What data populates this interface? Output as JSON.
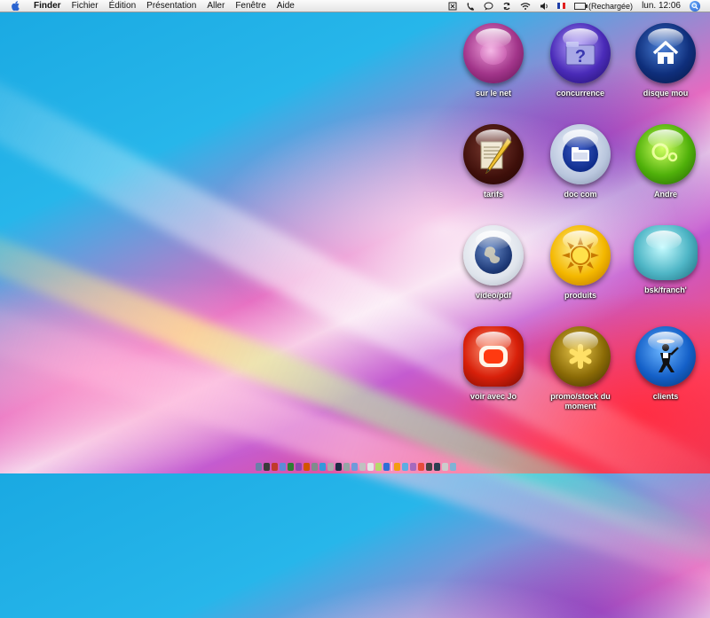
{
  "menubar": {
    "app_name": "Finder",
    "menus": [
      "Fichier",
      "Édition",
      "Présentation",
      "Aller",
      "Fenêtre",
      "Aide"
    ],
    "battery_status": "(Rechargée)",
    "clock": "lun. 12:06",
    "status_icons": [
      "bluetooth-icon",
      "phone-icon",
      "chat-icon",
      "sync-icon",
      "wifi-icon",
      "volume-icon"
    ]
  },
  "desktop": {
    "icons": [
      {
        "label": "sur le net",
        "icon": "globe-bubble-icon"
      },
      {
        "label": "concurrence",
        "icon": "question-folder-icon"
      },
      {
        "label": "disque mou",
        "icon": "home-icon"
      },
      {
        "label": "tarifs",
        "icon": "document-pencil-icon"
      },
      {
        "label": "doc com",
        "icon": "folder-icon"
      },
      {
        "label": "Andre",
        "icon": "green-bubble-icon"
      },
      {
        "label": "video/pdf",
        "icon": "earth-icon"
      },
      {
        "label": "produits",
        "icon": "sun-icon"
      },
      {
        "label": "bsk/franch'",
        "icon": "teal-bubble-icon"
      },
      {
        "label": "voir avec Jo",
        "icon": "tv-icon"
      },
      {
        "label": "promo/stock du\nmoment",
        "icon": "star-icon"
      },
      {
        "label": "clients",
        "icon": "waiter-icon"
      }
    ]
  },
  "dock": {
    "colors": [
      "#6b7fa8",
      "#3a3a3a",
      "#c0392b",
      "#5d8bd6",
      "#2e7d32",
      "#8e44ad",
      "#d35400",
      "#7f8c8d",
      "#3498db",
      "#aaaaaa",
      "#1f2a44",
      "#95a5a6",
      "#6f9ad9",
      "#c0c0c0",
      "#e6e6e6",
      "#b5d86a",
      "#2f6fd6",
      "#f39c12",
      "#5dade2",
      "#a569bd",
      "#e74c3c",
      "#444444",
      "#2c3e50",
      "#cccccc",
      "#7fb3d5"
    ]
  }
}
